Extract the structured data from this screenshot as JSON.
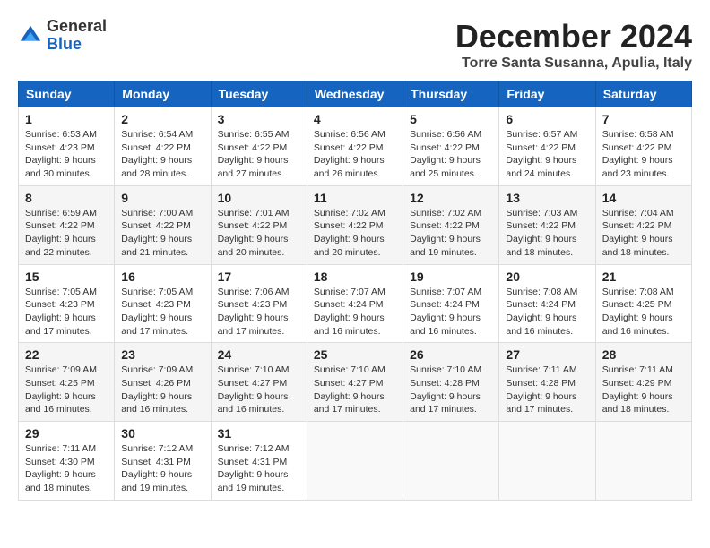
{
  "logo": {
    "general": "General",
    "blue": "Blue"
  },
  "header": {
    "month": "December 2024",
    "location": "Torre Santa Susanna, Apulia, Italy"
  },
  "days_of_week": [
    "Sunday",
    "Monday",
    "Tuesday",
    "Wednesday",
    "Thursday",
    "Friday",
    "Saturday"
  ],
  "weeks": [
    [
      {
        "day": "1",
        "sunrise": "6:53 AM",
        "sunset": "4:23 PM",
        "daylight": "9 hours and 30 minutes."
      },
      {
        "day": "2",
        "sunrise": "6:54 AM",
        "sunset": "4:22 PM",
        "daylight": "9 hours and 28 minutes."
      },
      {
        "day": "3",
        "sunrise": "6:55 AM",
        "sunset": "4:22 PM",
        "daylight": "9 hours and 27 minutes."
      },
      {
        "day": "4",
        "sunrise": "6:56 AM",
        "sunset": "4:22 PM",
        "daylight": "9 hours and 26 minutes."
      },
      {
        "day": "5",
        "sunrise": "6:56 AM",
        "sunset": "4:22 PM",
        "daylight": "9 hours and 25 minutes."
      },
      {
        "day": "6",
        "sunrise": "6:57 AM",
        "sunset": "4:22 PM",
        "daylight": "9 hours and 24 minutes."
      },
      {
        "day": "7",
        "sunrise": "6:58 AM",
        "sunset": "4:22 PM",
        "daylight": "9 hours and 23 minutes."
      }
    ],
    [
      {
        "day": "8",
        "sunrise": "6:59 AM",
        "sunset": "4:22 PM",
        "daylight": "9 hours and 22 minutes."
      },
      {
        "day": "9",
        "sunrise": "7:00 AM",
        "sunset": "4:22 PM",
        "daylight": "9 hours and 21 minutes."
      },
      {
        "day": "10",
        "sunrise": "7:01 AM",
        "sunset": "4:22 PM",
        "daylight": "9 hours and 20 minutes."
      },
      {
        "day": "11",
        "sunrise": "7:02 AM",
        "sunset": "4:22 PM",
        "daylight": "9 hours and 20 minutes."
      },
      {
        "day": "12",
        "sunrise": "7:02 AM",
        "sunset": "4:22 PM",
        "daylight": "9 hours and 19 minutes."
      },
      {
        "day": "13",
        "sunrise": "7:03 AM",
        "sunset": "4:22 PM",
        "daylight": "9 hours and 18 minutes."
      },
      {
        "day": "14",
        "sunrise": "7:04 AM",
        "sunset": "4:22 PM",
        "daylight": "9 hours and 18 minutes."
      }
    ],
    [
      {
        "day": "15",
        "sunrise": "7:05 AM",
        "sunset": "4:23 PM",
        "daylight": "9 hours and 17 minutes."
      },
      {
        "day": "16",
        "sunrise": "7:05 AM",
        "sunset": "4:23 PM",
        "daylight": "9 hours and 17 minutes."
      },
      {
        "day": "17",
        "sunrise": "7:06 AM",
        "sunset": "4:23 PM",
        "daylight": "9 hours and 17 minutes."
      },
      {
        "day": "18",
        "sunrise": "7:07 AM",
        "sunset": "4:24 PM",
        "daylight": "9 hours and 16 minutes."
      },
      {
        "day": "19",
        "sunrise": "7:07 AM",
        "sunset": "4:24 PM",
        "daylight": "9 hours and 16 minutes."
      },
      {
        "day": "20",
        "sunrise": "7:08 AM",
        "sunset": "4:24 PM",
        "daylight": "9 hours and 16 minutes."
      },
      {
        "day": "21",
        "sunrise": "7:08 AM",
        "sunset": "4:25 PM",
        "daylight": "9 hours and 16 minutes."
      }
    ],
    [
      {
        "day": "22",
        "sunrise": "7:09 AM",
        "sunset": "4:25 PM",
        "daylight": "9 hours and 16 minutes."
      },
      {
        "day": "23",
        "sunrise": "7:09 AM",
        "sunset": "4:26 PM",
        "daylight": "9 hours and 16 minutes."
      },
      {
        "day": "24",
        "sunrise": "7:10 AM",
        "sunset": "4:27 PM",
        "daylight": "9 hours and 16 minutes."
      },
      {
        "day": "25",
        "sunrise": "7:10 AM",
        "sunset": "4:27 PM",
        "daylight": "9 hours and 17 minutes."
      },
      {
        "day": "26",
        "sunrise": "7:10 AM",
        "sunset": "4:28 PM",
        "daylight": "9 hours and 17 minutes."
      },
      {
        "day": "27",
        "sunrise": "7:11 AM",
        "sunset": "4:28 PM",
        "daylight": "9 hours and 17 minutes."
      },
      {
        "day": "28",
        "sunrise": "7:11 AM",
        "sunset": "4:29 PM",
        "daylight": "9 hours and 18 minutes."
      }
    ],
    [
      {
        "day": "29",
        "sunrise": "7:11 AM",
        "sunset": "4:30 PM",
        "daylight": "9 hours and 18 minutes."
      },
      {
        "day": "30",
        "sunrise": "7:12 AM",
        "sunset": "4:31 PM",
        "daylight": "9 hours and 19 minutes."
      },
      {
        "day": "31",
        "sunrise": "7:12 AM",
        "sunset": "4:31 PM",
        "daylight": "9 hours and 19 minutes."
      },
      null,
      null,
      null,
      null
    ]
  ]
}
